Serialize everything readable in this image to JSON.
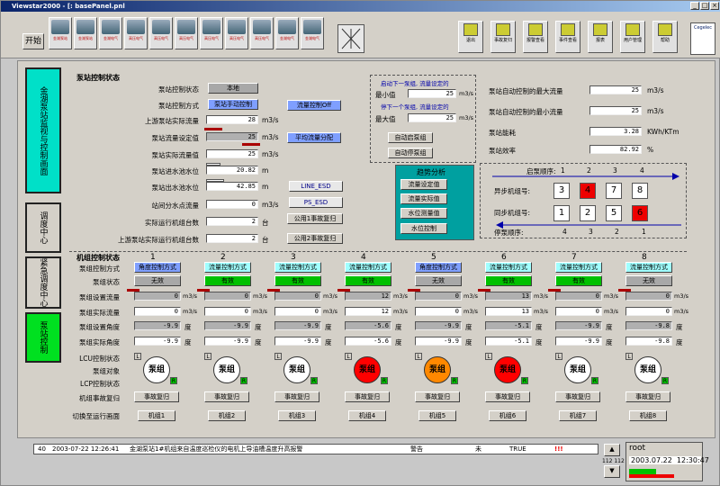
{
  "window": {
    "title": "Viewstar2000 - [: basePanel.pnl",
    "min": "_",
    "max": "□",
    "close": "×"
  },
  "toolbar": {
    "start": "开始",
    "left_buttons": [
      "金湖泵站",
      "金湖泵站",
      "金湖电气",
      "高压电气",
      "高压电气",
      "高压电气",
      "高压电气",
      "高压电气",
      "高压电气",
      "金湖电气",
      "金湖电气"
    ],
    "right_buttons": [
      "退出",
      "事故复归",
      "报警查看",
      "事件查看",
      "报表",
      "用户管理",
      "帮助"
    ],
    "logo": "Cegelec"
  },
  "sidebar": {
    "title": "金湖泵站监视与控制画面",
    "items": [
      "调度中心",
      "紧急调度中心",
      "泵站控制"
    ]
  },
  "pump_status": {
    "heading": "泵站控制状态",
    "rows": [
      {
        "label": "泵站控制状态",
        "value": "本地"
      },
      {
        "label": "泵站控制方式",
        "value": "泵站手动控制"
      },
      {
        "label": "上游泵站实际流量",
        "value": "28",
        "unit": "m3/s"
      },
      {
        "label": "泵站流量设定值",
        "value": "25",
        "unit": "m3/s"
      },
      {
        "label": "泵站实际流量值",
        "value": "25",
        "unit": "m3/s"
      },
      {
        "label": "泵站进水池水位",
        "value": "20.82",
        "unit": "m"
      },
      {
        "label": "泵站出水池水位",
        "value": "42.85",
        "unit": "m"
      },
      {
        "label": "站间分水点流量",
        "value": "0",
        "unit": "m3/s"
      },
      {
        "label": "实际运行机组台数",
        "value": "2",
        "unit": "台"
      },
      {
        "label": "上游泵站实际运行机组台数",
        "value": "2",
        "unit": "台"
      }
    ],
    "flow_off": "流量控制Off",
    "avg_flow": "平均流量分配",
    "line_esd": "LINE_ESD",
    "ps_esd": "PS_ESD",
    "public1": "公用1事故复归",
    "public2": "公用2事故复归"
  },
  "startstop": {
    "start_line": "启动下一泵组, 流量设定的",
    "min_label": "最小值",
    "min_value": "25",
    "stop_line": "停下一个泵组, 流量设定的",
    "max_label": "最大值",
    "max_value": "25",
    "unit": "m3/s",
    "auto_start": "自动启泵组",
    "auto_stop": "自动停泵组"
  },
  "trend": {
    "title": "趋势分析",
    "items": [
      "流量设定值",
      "流量实际值",
      "水位测量值",
      "水位控制"
    ]
  },
  "right_info": [
    {
      "label": "泵站自动控制的最大流量",
      "value": "25",
      "unit": "m3/s"
    },
    {
      "label": "泵站自动控制的最小流量",
      "value": "25",
      "unit": "m3/s"
    },
    {
      "label": "泵站能耗",
      "value": "3.28",
      "unit": "KWh/KTm"
    },
    {
      "label": "泵站效率",
      "value": "82.92",
      "unit": "%"
    }
  ],
  "sequence": {
    "start_label": "启泵顺序:",
    "start_nums": [
      "1",
      "2",
      "3",
      "4"
    ],
    "async_label": "异步机组号:",
    "async": [
      "3",
      "4",
      "7",
      "8"
    ],
    "sync_label": "同步机组号:",
    "sync": [
      "1",
      "2",
      "5",
      "6"
    ],
    "stop_label": "停泵顺序:",
    "stop_nums": [
      "4",
      "3",
      "2",
      "1"
    ]
  },
  "unit_status": {
    "heading": "机组控制状态",
    "row_labels": [
      "泵组控制方式",
      "泵组状态",
      "泵组设置流量",
      "泵组实际流量",
      "泵组设置角度",
      "泵组实际角度",
      "LCU控制状态",
      "泵组对象",
      "LCP控制状态",
      "机组事故复归",
      "切换至运行画面"
    ],
    "units": [
      {
        "num": "1",
        "mode": "角度控制方式",
        "state": "无效",
        "setflow": "0",
        "actflow": "0",
        "setang": "-9.9",
        "actang": "-9.9",
        "obj": "泵组",
        "reset": "事故复归",
        "goto": "机组1",
        "modeblue": true,
        "stategreen": false,
        "color": "#ffffff"
      },
      {
        "num": "2",
        "mode": "流量控制方式",
        "state": "有效",
        "setflow": "0",
        "actflow": "0",
        "setang": "-9.9",
        "actang": "-9.9",
        "obj": "泵组",
        "reset": "事故复归",
        "goto": "机组2",
        "modeblue": false,
        "stategreen": true,
        "color": "#ffffff"
      },
      {
        "num": "3",
        "mode": "流量控制方式",
        "state": "有效",
        "setflow": "0",
        "actflow": "0",
        "setang": "-9.9",
        "actang": "-9.9",
        "obj": "泵组",
        "reset": "事故复归",
        "goto": "机组3",
        "modeblue": false,
        "stategreen": true,
        "color": "#ffffff"
      },
      {
        "num": "4",
        "mode": "流量控制方式",
        "state": "有效",
        "setflow": "12",
        "actflow": "12",
        "setang": "-5.6",
        "actang": "-5.6",
        "obj": "泵组",
        "reset": "事故复归",
        "goto": "机组4",
        "modeblue": false,
        "stategreen": true,
        "color": "#ff0000"
      },
      {
        "num": "5",
        "mode": "角度控制方式",
        "state": "无效",
        "setflow": "0",
        "actflow": "0",
        "setang": "-9.9",
        "actang": "-9.9",
        "obj": "泵组",
        "reset": "事故复归",
        "goto": "机组5",
        "modeblue": true,
        "stategreen": false,
        "color": "#ff8800"
      },
      {
        "num": "6",
        "mode": "流量控制方式",
        "state": "有效",
        "setflow": "13",
        "actflow": "13",
        "setang": "-5.1",
        "actang": "-5.1",
        "obj": "泵组",
        "reset": "事故复归",
        "goto": "机组6",
        "modeblue": false,
        "stategreen": true,
        "color": "#ff0000"
      },
      {
        "num": "7",
        "mode": "流量控制方式",
        "state": "有效",
        "setflow": "0",
        "actflow": "0",
        "setang": "-9.9",
        "actang": "-9.9",
        "obj": "泵组",
        "reset": "事故复归",
        "goto": "机组7",
        "modeblue": false,
        "stategreen": true,
        "color": "#ffffff"
      },
      {
        "num": "8",
        "mode": "流量控制方式",
        "state": "无效",
        "setflow": "0",
        "actflow": "0",
        "setang": "-9.8",
        "actang": "-9.8",
        "obj": "泵组",
        "reset": "事故复归",
        "goto": "机组8",
        "modeblue": false,
        "stategreen": false,
        "color": "#ffffff"
      }
    ],
    "units_flow": "m3/s",
    "units_angle": "度"
  },
  "statusbar": {
    "num": "40",
    "time": "2003-07-22 12:26:41",
    "msg": "金湖泵站1#机组来自温度巡检仪的电机上导油槽温度升高报警",
    "level": "警告",
    "flag": "未",
    "state": "TRUE",
    "mark": "!!!"
  },
  "clock": {
    "user": "root",
    "date": "2003.07.22",
    "time": "12:30:47",
    "pages": "112 112"
  }
}
